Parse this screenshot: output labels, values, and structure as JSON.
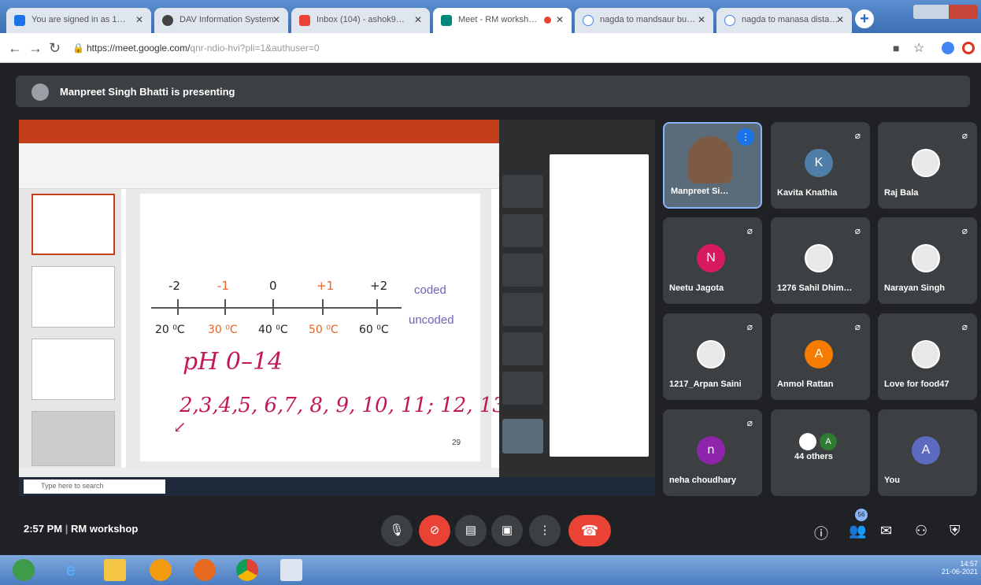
{
  "browser": {
    "tabs": [
      {
        "label": "You are signed in as 1…"
      },
      {
        "label": "DAV Information System"
      },
      {
        "label": "Inbox (104) - ashok9…"
      },
      {
        "label": "Meet - RM worksh…"
      },
      {
        "label": "nagda to mandsaur bu…"
      },
      {
        "label": "nagda to manasa dista…"
      }
    ],
    "url_host": "https://meet.google.com/",
    "url_path": "qnr-ndio-hvi?pli=1&authuser=0"
  },
  "presenting_label": "Manpreet Singh Bhatti is presenting",
  "slide": {
    "coded_values": [
      "-2",
      "-1",
      "0",
      "+1",
      "+2"
    ],
    "uncoded_values": [
      "20 ⁰C",
      "30 ⁰C",
      "40 ⁰C",
      "50 ⁰C",
      "60 ⁰C"
    ],
    "coded_label": "coded",
    "uncoded_label": "uncoded",
    "hand_line1": "pH 0–14",
    "hand_line2": "2,3,4,5, 6,7, 8, 9, 10, 11; 12, 13",
    "page_number": "29",
    "taskbar_search": "Type here to search"
  },
  "participants": [
    {
      "name": "Manpreet Si…",
      "initial": "",
      "color": "",
      "kind": "video"
    },
    {
      "name": "Kavita Knathia",
      "initial": "K",
      "color": "#4f7ea8",
      "kind": "avatar"
    },
    {
      "name": "Raj Bala",
      "initial": "",
      "color": "",
      "kind": "photo"
    },
    {
      "name": "Neetu Jagota",
      "initial": "N",
      "color": "#d81b60",
      "kind": "avatar"
    },
    {
      "name": "1276 Sahil Dhim…",
      "initial": "",
      "color": "",
      "kind": "photo"
    },
    {
      "name": "Narayan Singh",
      "initial": "",
      "color": "",
      "kind": "photo"
    },
    {
      "name": "1217_Arpan Saini",
      "initial": "",
      "color": "",
      "kind": "photo"
    },
    {
      "name": "Anmol Rattan",
      "initial": "A",
      "color": "#f57c00",
      "kind": "avatar"
    },
    {
      "name": "Love for food47",
      "initial": "",
      "color": "",
      "kind": "photo"
    },
    {
      "name": "neha choudhary",
      "initial": "n",
      "color": "#8e24aa",
      "kind": "avatar"
    },
    {
      "name": "44 others",
      "initial": "A",
      "color": "#2e7d32",
      "kind": "others"
    },
    {
      "name": "You",
      "initial": "A",
      "color": "#5c6bc0",
      "kind": "avatar"
    }
  ],
  "bottom": {
    "time": "2:57 PM",
    "separator": "|",
    "meeting_name": "RM workshop",
    "people_count": "56"
  },
  "taskbar": {
    "clock_time": "14:57",
    "clock_date": "21-06-2021"
  }
}
